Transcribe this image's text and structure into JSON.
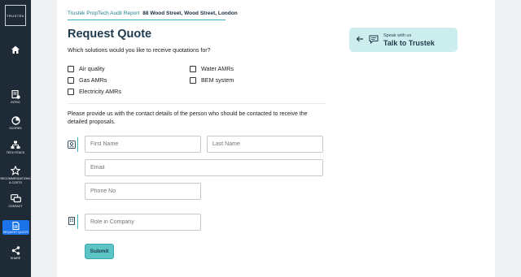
{
  "logo": {
    "text": "TRUSTEK"
  },
  "sidebar": {
    "items": [
      {
        "label": "",
        "icon": "home-icon"
      },
      {
        "label": "INTRO",
        "icon": "intro-icon"
      },
      {
        "label": "SCORES",
        "icon": "pie-chart-icon"
      },
      {
        "label": "TECH STACK",
        "icon": "tech-stack-icon"
      },
      {
        "label": "RECOMMENDATIONS & COSTS",
        "icon": "star-icon"
      },
      {
        "label": "CONTACT",
        "icon": "chat-icon"
      },
      {
        "label": "REQUEST QUOTE",
        "icon": "document-icon"
      },
      {
        "label": "SHARE",
        "icon": "share-icon"
      }
    ],
    "active": "REQUEST QUOTE",
    "active_color": "#1a73e8"
  },
  "breadcrumb": {
    "report": "Trustek PropTech Audit Report",
    "address": "88 Wood Street, Wood Street, London"
  },
  "page": {
    "title": "Request Quote",
    "question": "Which solutions would you like to receive quotations for?",
    "contact_text": "Please provide us with the contact details of the person who should be contacted to receive the detailed proposals."
  },
  "solutions": {
    "air_quality": "Air quality",
    "gas_amrs": "Gas AMRs",
    "electricity_amrs": "Electricity AMRs",
    "water_amrs": "Water AMRs",
    "bem_system": "BEM system"
  },
  "form": {
    "first_name": "First Name",
    "last_name": "Last Name",
    "email": "Email",
    "phone": "Phone No",
    "role": "Role in Company",
    "submit": "Submit"
  },
  "talk": {
    "small": "Speak with us",
    "big": "Talk to Trustek"
  },
  "colors": {
    "accent": "#5cc4c4",
    "title": "#1f3a4d",
    "panel": "#cdeeee"
  }
}
